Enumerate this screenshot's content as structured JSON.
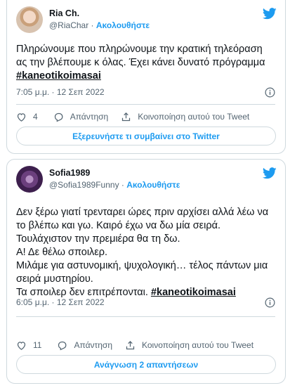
{
  "tweets": [
    {
      "name": "Ria Ch.",
      "handle": "@RiaChar",
      "separator": " · ",
      "follow_label": "Ακολουθήστε",
      "text": "Πληρώνουμε που πληρώνουμε την κρατική τηλεόραση ας την βλέπουμε κ όλας. Έχει κάνει δυνατό πρόγραμμα  ",
      "hashtag": "#kaneotikoimasai",
      "timestamp": "7:05 μ.μ. · 12 Σεπ 2022",
      "likes": "4",
      "reply_label": "Απάντηση",
      "share_label": "Κοινοποίηση αυτού του Tweet",
      "button_label": "Εξερευνήστε τι συμβαίνει στο Twitter"
    },
    {
      "name": "Sofia1989",
      "handle": "@Sofia1989Funny",
      "separator": " · ",
      "follow_label": "Ακολουθήστε",
      "lines": [
        "Δεν ξέρω γιατί τρενταρει ώρες πριν αρχίσει αλλά λέω να το βλέπω και γω. Καιρό έχω να δω μία σειρά.",
        "Τουλάχιστον την πρεμιέρα θα τη δω.",
        "Α! Δε θέλω σποιλερ.",
        "Μιλάμε για αστυνομική, ψυχολογική… τέλος πάντων μια σειρά μυστηρίου.",
        "Τα σποιλερ δεν επιτρέπονται. "
      ],
      "hashtag": "#kaneotikoimasai",
      "timestamp": "6:05 μ.μ. · 12 Σεπ 2022",
      "likes": "11",
      "reply_label": "Απάντηση",
      "share_label": "Κοινοποίηση αυτού του Tweet",
      "button_label": "Ανάγνωση 2 απαντήσεων"
    }
  ],
  "colors": {
    "accent": "#1d9bf0",
    "text": "#0f1419",
    "muted": "#536471",
    "border": "#cfd9de"
  },
  "icons": [
    "twitter-bird-icon",
    "info-icon",
    "heart-icon",
    "reply-icon",
    "share-icon"
  ]
}
